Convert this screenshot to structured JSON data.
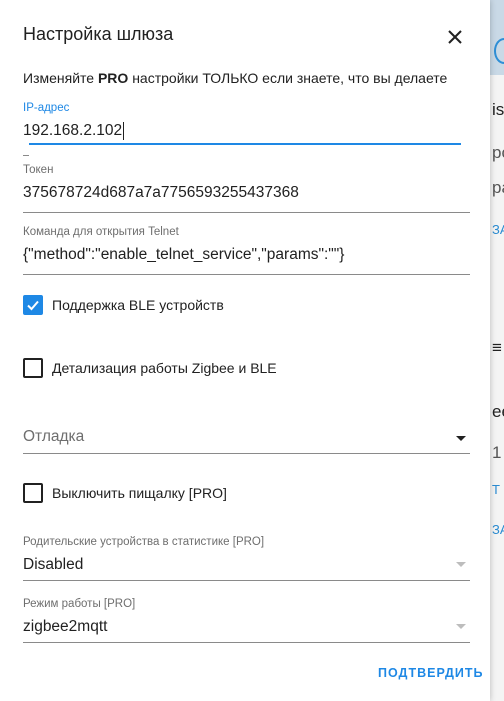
{
  "dialog": {
    "title": "Настройка шлюза",
    "warning_prefix": "Изменяйте ",
    "warning_bold": "PRO",
    "warning_suffix": " настройки ТОЛЬКО если знаете, что вы делаете",
    "confirm_label": "ПОДТВЕРДИТЬ"
  },
  "fields": {
    "ip": {
      "label": "IP-адрес",
      "value": "192.168.2.102"
    },
    "token": {
      "label": "Токен",
      "value": "375678724d687a7a7756593255437368"
    },
    "telnet": {
      "label": "Команда для открытия Telnet",
      "value": "{\"method\":\"enable_telnet_service\",\"params\":\"\"}"
    },
    "debug": {
      "placeholder": "Отладка"
    },
    "parent_devices": {
      "label": "Родительские устройства в статистике [PRO]",
      "value": "Disabled"
    },
    "mode": {
      "label": "Режим работы [PRO]",
      "value": "zigbee2mqtt"
    }
  },
  "checkboxes": {
    "ble": {
      "label": "Поддержка BLE устройств",
      "checked": true
    },
    "zigbee_detail": {
      "label": "Детализация работы Zigbee и BLE",
      "checked": false
    },
    "buzzer": {
      "label": "Выключить пищалку [PRO]",
      "checked": false
    }
  },
  "background": {
    "letters": [
      "is",
      "ро",
      "ра",
      "ЗА",
      "≡",
      "ee",
      "1",
      "Т",
      "ЗА"
    ]
  },
  "colors": {
    "accent": "#1e88e5",
    "text": "#212121",
    "label": "#6e6e6e"
  },
  "icons": {
    "close": "close-icon",
    "check": "check-icon",
    "dropdown": "chevron-down-icon"
  }
}
